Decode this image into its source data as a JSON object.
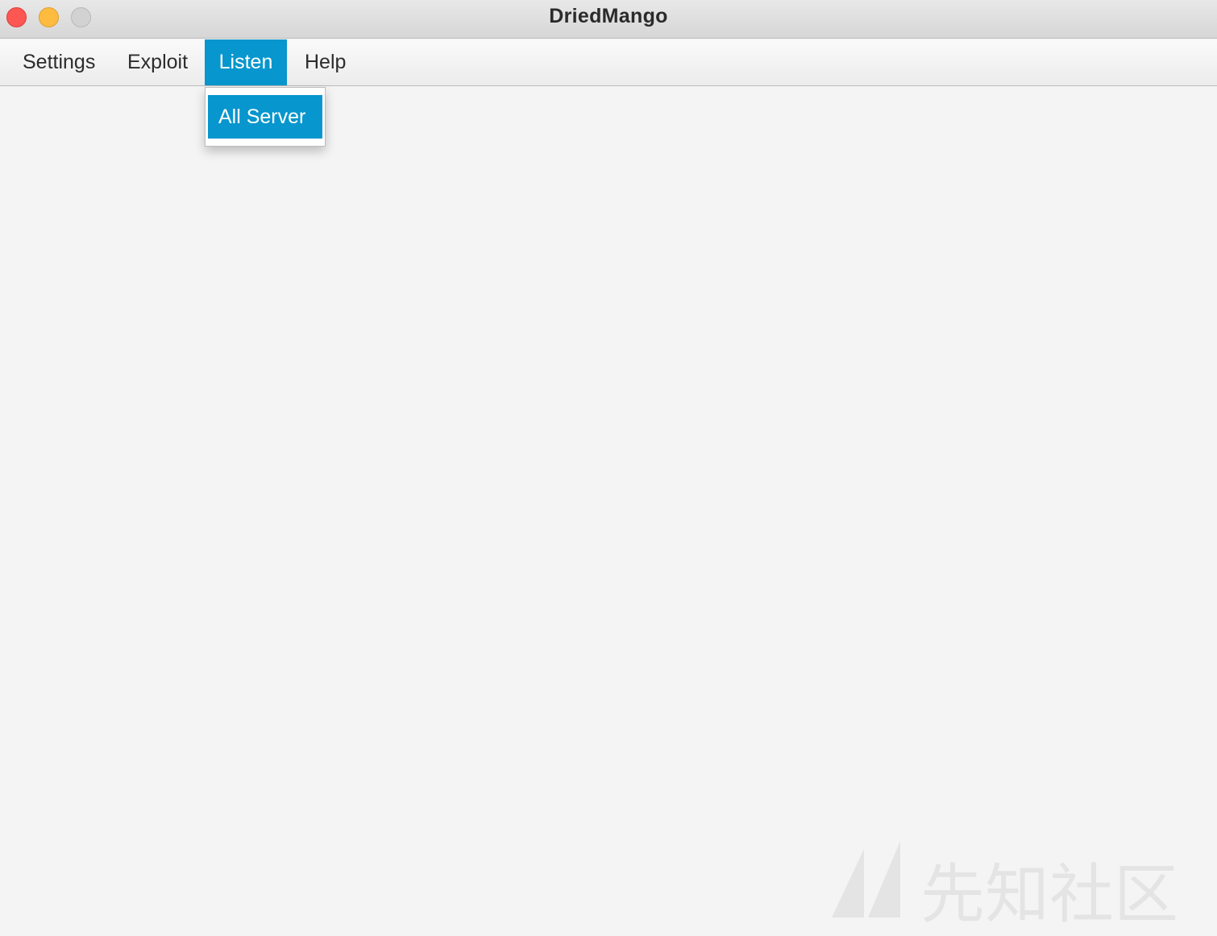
{
  "window": {
    "title": "DriedMango",
    "controls": [
      "close",
      "minimize",
      "maximize"
    ]
  },
  "menubar": {
    "items": [
      {
        "label": "Settings"
      },
      {
        "label": "Exploit"
      },
      {
        "label": "Listen",
        "active": true
      },
      {
        "label": "Help"
      }
    ]
  },
  "dropdown": {
    "parent": "Listen",
    "items": [
      {
        "label": "All Server",
        "highlighted": true
      }
    ]
  },
  "watermark": {
    "text": "先知社区"
  },
  "colors": {
    "accent": "#0796cd",
    "background": "#f4f4f4",
    "close": "#fc5753",
    "minimize": "#fdbc40",
    "maximize": "#d2d2d2"
  }
}
